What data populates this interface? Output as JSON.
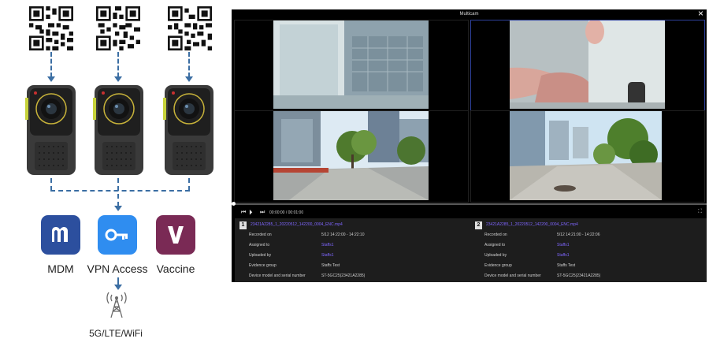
{
  "diagram": {
    "apps": [
      {
        "label": "MDM",
        "glyph": "m",
        "color": "#2c4f9e"
      },
      {
        "label": "VPN Access",
        "glyph": "key",
        "color": "#2f8df0"
      },
      {
        "label": "Vaccine",
        "glyph": "V",
        "color": "#7a2a55"
      }
    ],
    "network_label": "5G/LTE/WiFi",
    "line_color": "#3b6ea3"
  },
  "multicam": {
    "title": "Multicam",
    "close": "×",
    "time": "00:00:00 / 00:01:00",
    "panels": [
      {
        "num": "1",
        "file": "23421A2285_1_20220512_142200_0004_ENC.mp4",
        "rows": [
          {
            "label": "Recorded on",
            "value": "5/12 14:22:00 - 14:22:10",
            "link": false
          },
          {
            "label": "Assigned to",
            "value": "Staffs1",
            "link": true
          },
          {
            "label": "Uploaded by",
            "value": "Staffs1",
            "link": true
          },
          {
            "label": "Evidence group",
            "value": "Staffs Test",
            "link": false
          },
          {
            "label": "Device model and serial number",
            "value": "ST-5GC25(23421A2285)",
            "link": false
          }
        ]
      },
      {
        "num": "2",
        "file": "23421A2285_1_20220512_142200_0004_ENC.mp4",
        "rows": [
          {
            "label": "Recorded on",
            "value": "5/12 14:21:00 - 14:22:06",
            "link": false
          },
          {
            "label": "Assigned to",
            "value": "Staffs1",
            "link": true
          },
          {
            "label": "Uploaded by",
            "value": "Staffs1",
            "link": true
          },
          {
            "label": "Evidence group",
            "value": "Staffs Test",
            "link": false
          },
          {
            "label": "Device model and serial number",
            "value": "ST-5GC25(23421A2285)",
            "link": false
          }
        ]
      }
    ]
  }
}
